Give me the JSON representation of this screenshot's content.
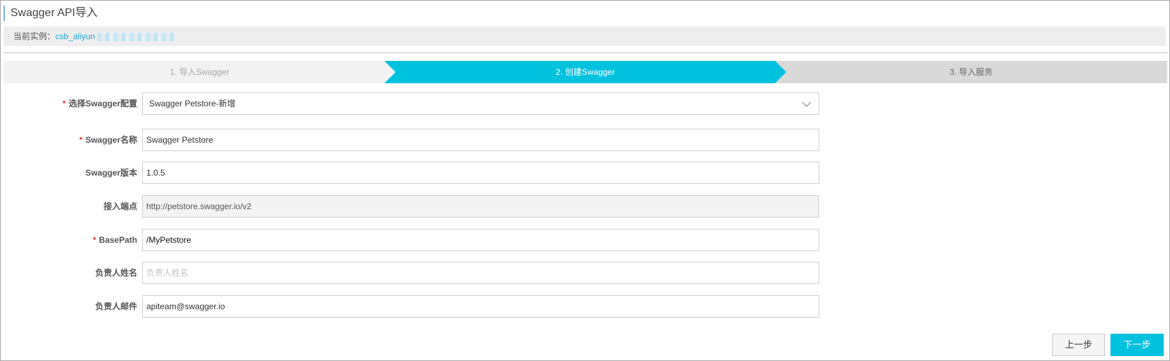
{
  "header": {
    "title": "Swagger API导入"
  },
  "instance": {
    "label": "当前实例：",
    "value": "csb_aliyun"
  },
  "steps": [
    {
      "label": "1. 导入Swagger",
      "state": "done"
    },
    {
      "label": "2. 创建Swagger",
      "state": "active"
    },
    {
      "label": "3. 导入服务",
      "state": "pending"
    }
  ],
  "form": {
    "swagger_config": {
      "label": "选择Swagger配置",
      "required": true,
      "value": "Swagger Petstore-新增"
    },
    "swagger_name": {
      "label": "Swagger名称",
      "required": true,
      "value": "Swagger Petstore"
    },
    "swagger_version": {
      "label": "Swagger版本",
      "required": false,
      "value": "1.0.5"
    },
    "endpoint": {
      "label": "接入端点",
      "required": false,
      "value": "http://petstore.swagger.io/v2"
    },
    "base_path": {
      "label": "BasePath",
      "required": true,
      "value": "/MyPetstore"
    },
    "owner_name": {
      "label": "负责人姓名",
      "required": false,
      "value": "",
      "placeholder": "负责人姓名"
    },
    "owner_email": {
      "label": "负责人邮件",
      "required": false,
      "value": "apiteam@swagger.io"
    }
  },
  "required_mark": "*",
  "buttons": {
    "prev": "上一步",
    "next": "下一步"
  },
  "colors": {
    "accent": "#00c1de",
    "link": "#1fa5d6",
    "required": "#e03b3b"
  }
}
